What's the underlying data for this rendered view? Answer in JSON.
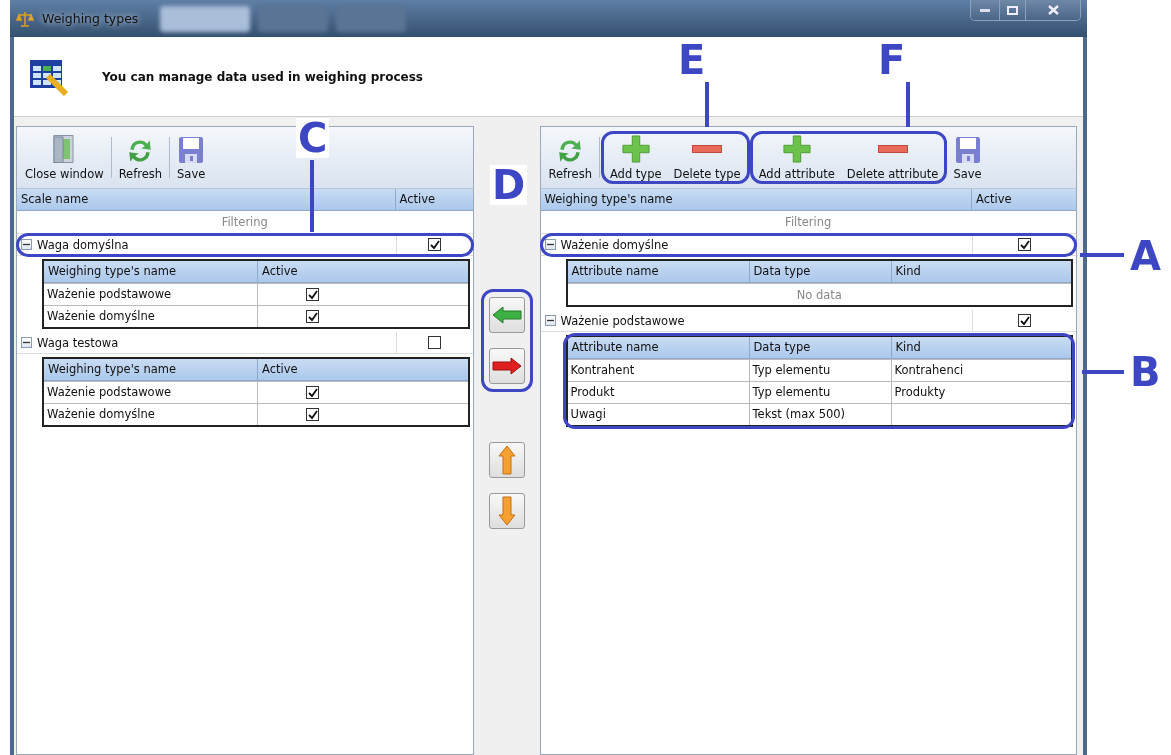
{
  "window": {
    "title": "Weighing types"
  },
  "header": {
    "text": "You can manage data used in weighing process"
  },
  "left_panel": {
    "toolbar": [
      {
        "kind": "close",
        "label": "Close window"
      },
      {
        "kind": "refresh",
        "label": "Refresh"
      },
      {
        "kind": "save",
        "label": "Save"
      }
    ],
    "columns": [
      "Scale name",
      "Active"
    ],
    "filter": "Filtering",
    "groups": [
      {
        "name": "Waga domyślna",
        "active": true,
        "expanded": true,
        "columns": [
          "Weighing type's name",
          "Active"
        ],
        "rows": [
          {
            "name": "Ważenie podstawowe",
            "active": true
          },
          {
            "name": "Ważenie domyślne",
            "active": true
          }
        ]
      },
      {
        "name": "Waga testowa",
        "active": false,
        "expanded": true,
        "columns": [
          "Weighing type's name",
          "Active"
        ],
        "rows": [
          {
            "name": "Ważenie podstawowe",
            "active": true
          },
          {
            "name": "Ważenie domyślne",
            "active": true
          }
        ]
      }
    ]
  },
  "move_buttons": [
    {
      "kind": "left"
    },
    {
      "kind": "right"
    },
    {
      "kind": "up"
    },
    {
      "kind": "down"
    }
  ],
  "right_panel": {
    "toolbar": [
      {
        "kind": "refresh",
        "label": "Refresh"
      },
      {
        "kind": "add",
        "label": "Add type"
      },
      {
        "kind": "delete",
        "label": "Delete type"
      },
      {
        "kind": "add",
        "label": "Add attribute"
      },
      {
        "kind": "delete",
        "label": "Delete attribute"
      },
      {
        "kind": "save",
        "label": "Save"
      }
    ],
    "columns": [
      "Weighing type's name",
      "Active"
    ],
    "filter": "Filtering",
    "groups": [
      {
        "name": "Ważenie domyślne",
        "active": true,
        "expanded": true,
        "columns": [
          "Attribute name",
          "Data type",
          "Kind"
        ],
        "empty_text": "No data"
      },
      {
        "name": "Ważenie podstawowe",
        "active": true,
        "expanded": true,
        "columns": [
          "Attribute name",
          "Data type",
          "Kind"
        ],
        "rows": [
          [
            "Kontrahent",
            "Typ elementu",
            "Kontrahenci"
          ],
          [
            "Produkt",
            "Typ elementu",
            "Produkty"
          ],
          [
            "Uwagi",
            "Tekst (max 500)",
            ""
          ]
        ]
      }
    ]
  },
  "annotations": [
    {
      "label": "E"
    },
    {
      "label": "F"
    },
    {
      "label": "C"
    },
    {
      "label": "D"
    },
    {
      "label": "A"
    },
    {
      "label": "B"
    }
  ]
}
